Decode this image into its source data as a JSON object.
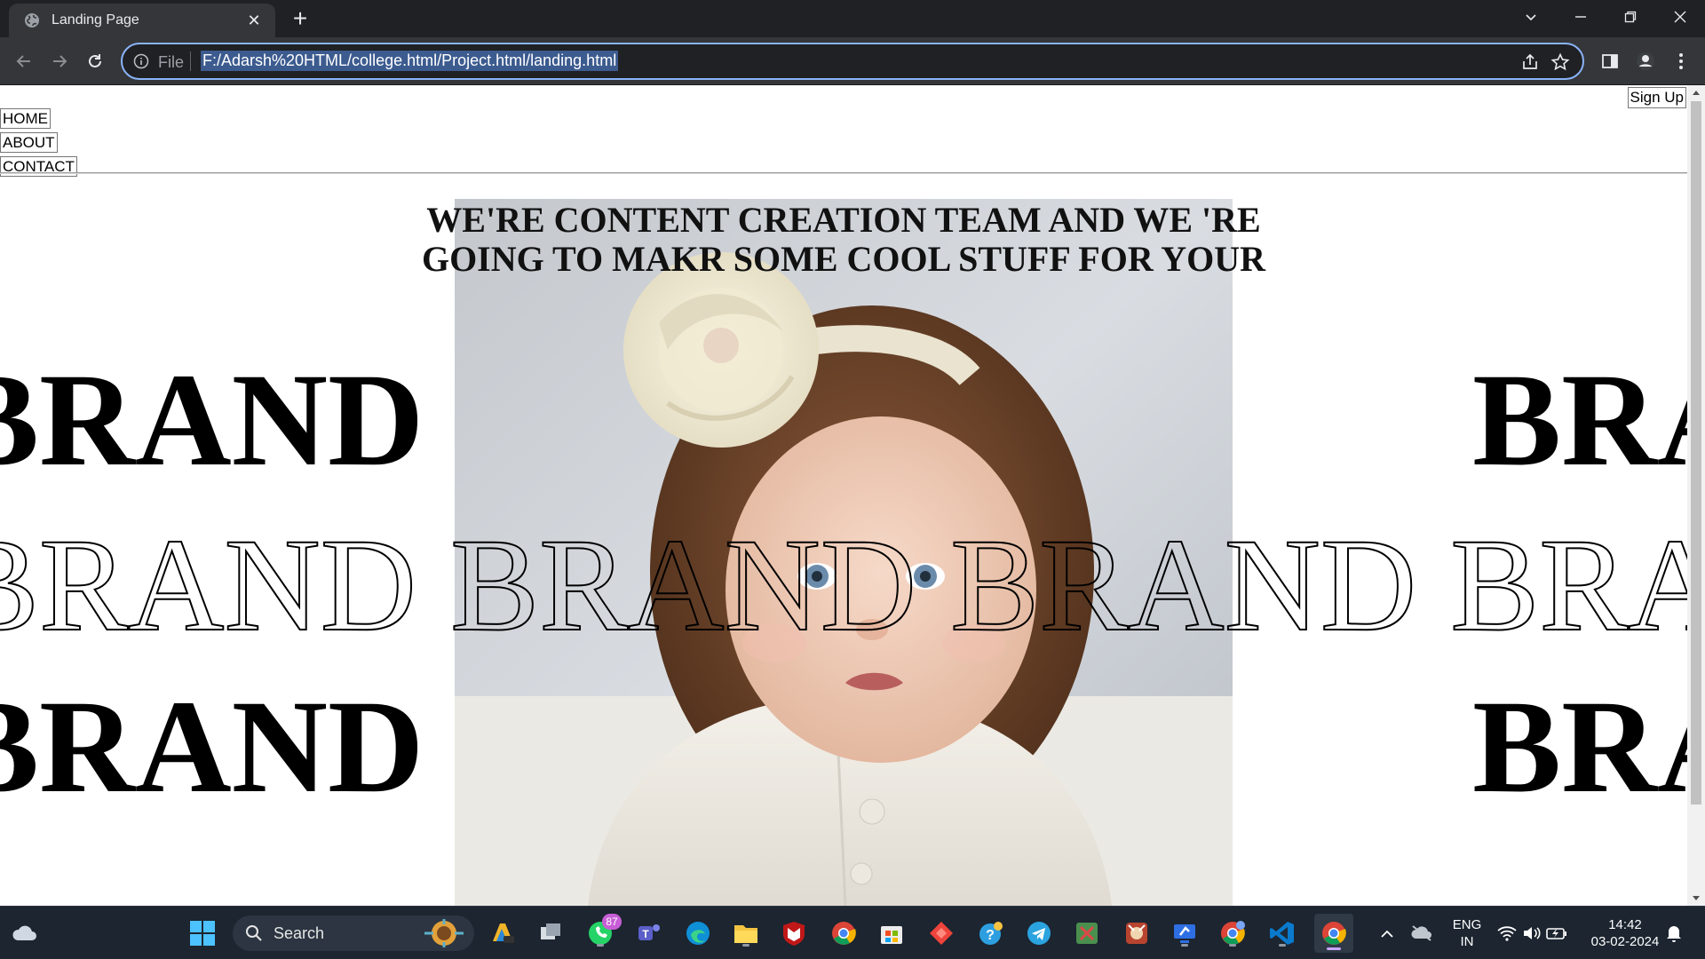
{
  "browser": {
    "tab_title": "Landing Page",
    "address_scheme": "File",
    "address_url": "F:/Adarsh%20HTML/college.html/Project.html/landing.html"
  },
  "page": {
    "signup_label": "Sign Up",
    "nav": [
      "HOME",
      "ABOUT",
      "CONTACT"
    ],
    "headline_line1": "WE'RE CONTENT CREATION TEAM AND WE 'RE",
    "headline_line2": "GOING TO MAKR SOME COOL STUFF FOR YOUR",
    "brand_word": "BRAND"
  },
  "taskbar": {
    "search_label": "Search",
    "whatsapp_badge": "87",
    "language_line1": "ENG",
    "language_line2": "IN",
    "time": "14:42",
    "date": "03-02-2024"
  }
}
